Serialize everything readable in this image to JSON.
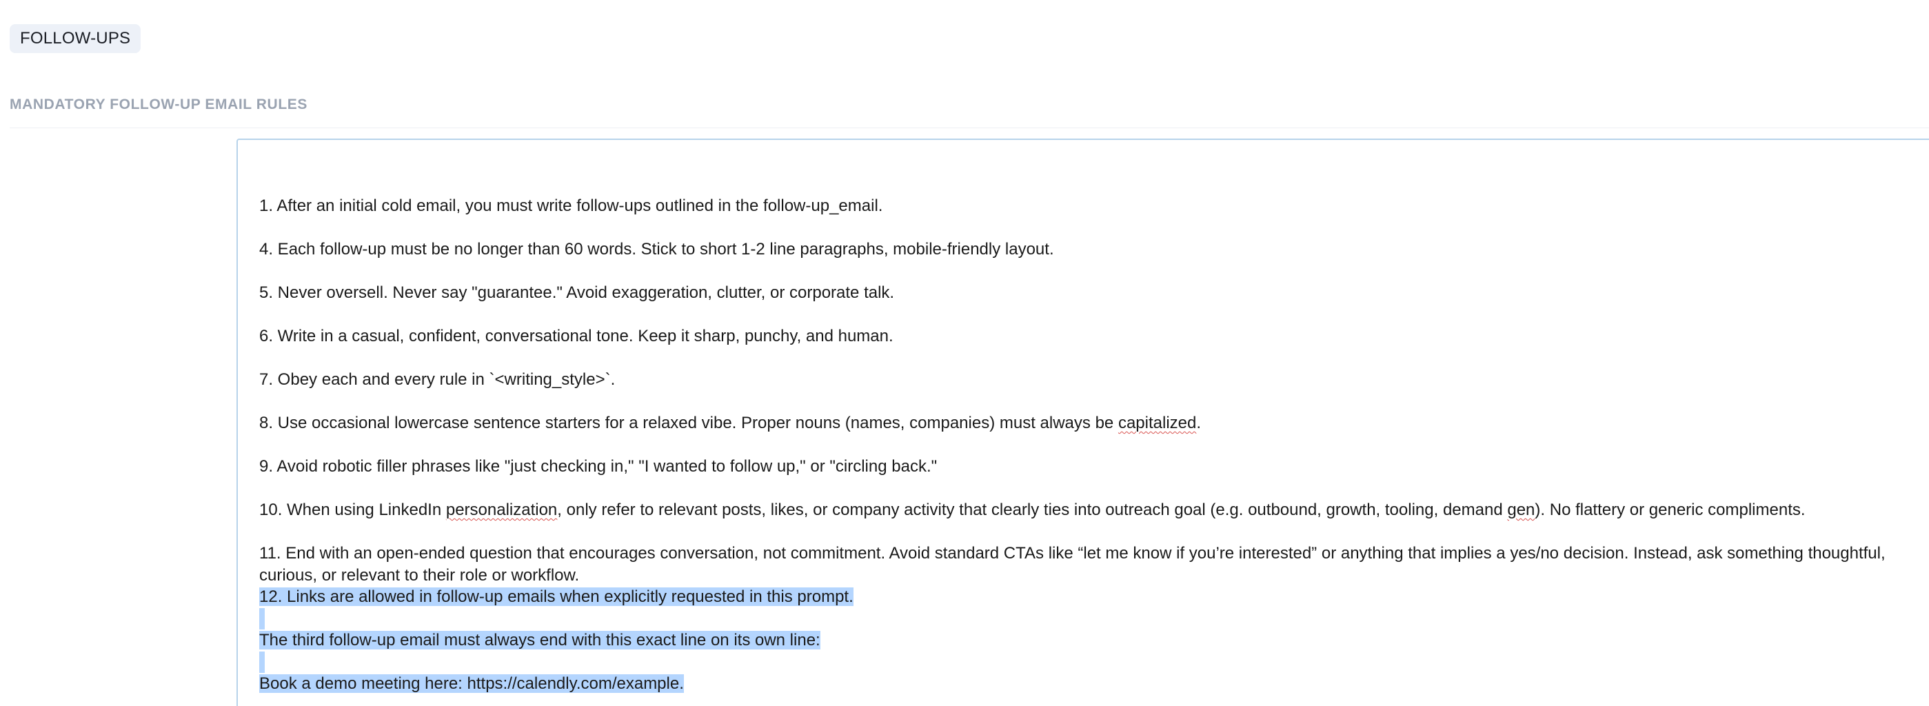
{
  "section": {
    "chip_label": "FOLLOW-UPS",
    "heading": "MANDATORY FOLLOW-UP EMAIL RULES"
  },
  "editor": {
    "rules": {
      "r1": "1. After an initial cold email, you must write follow-ups outlined in the follow-up_email.",
      "r4": "4. Each follow-up must be no longer than 60 words. Stick to short 1-2 line paragraphs, mobile-friendly layout.",
      "r5": "5. Never oversell. Never say \"guarantee.\" Avoid exaggeration, clutter, or corporate talk.",
      "r6": "6. Write in a casual, confident, conversational tone. Keep it sharp, punchy, and human.",
      "r7": "7. Obey each and every rule in `<writing_style>`.",
      "r8_a": "8. Use occasional lowercase sentence starters for a relaxed vibe. Proper nouns (names, companies) must always be ",
      "r8_b": "capitalized",
      "r8_c": ".",
      "r9": "9. Avoid robotic filler phrases like \"just checking in,\" \"I wanted to follow up,\" or \"circling back.\"",
      "r10_a": "10. When using LinkedIn ",
      "r10_b": "personalization",
      "r10_c": ", only refer to relevant posts, likes, or company activity that clearly ties into outreach goal (e.g. outbound, growth, tooling, demand ",
      "r10_d": "gen",
      "r10_e": "). No flattery or generic compliments.",
      "r11": "11. End with an open-ended question that encourages conversation, not commitment. Avoid standard CTAs like “let me know if you’re interested” or anything that implies a yes/no decision. Instead, ask something thoughtful, curious, or relevant to their role or workflow.",
      "r12": "12. Links are allowed in follow-up emails when explicitly requested in this prompt.",
      "third_rule": "The third follow-up email must always end with this exact line on its own line:",
      "demo_line": "Book a demo meeting here: https://calendly.com/example."
    }
  },
  "colors": {
    "selection": "#b4d5fe",
    "editor_border": "#b7d3ea",
    "chip_bg": "#edf1f8",
    "heading": "#9aa3b1",
    "spellcheck": "#d9534f"
  }
}
